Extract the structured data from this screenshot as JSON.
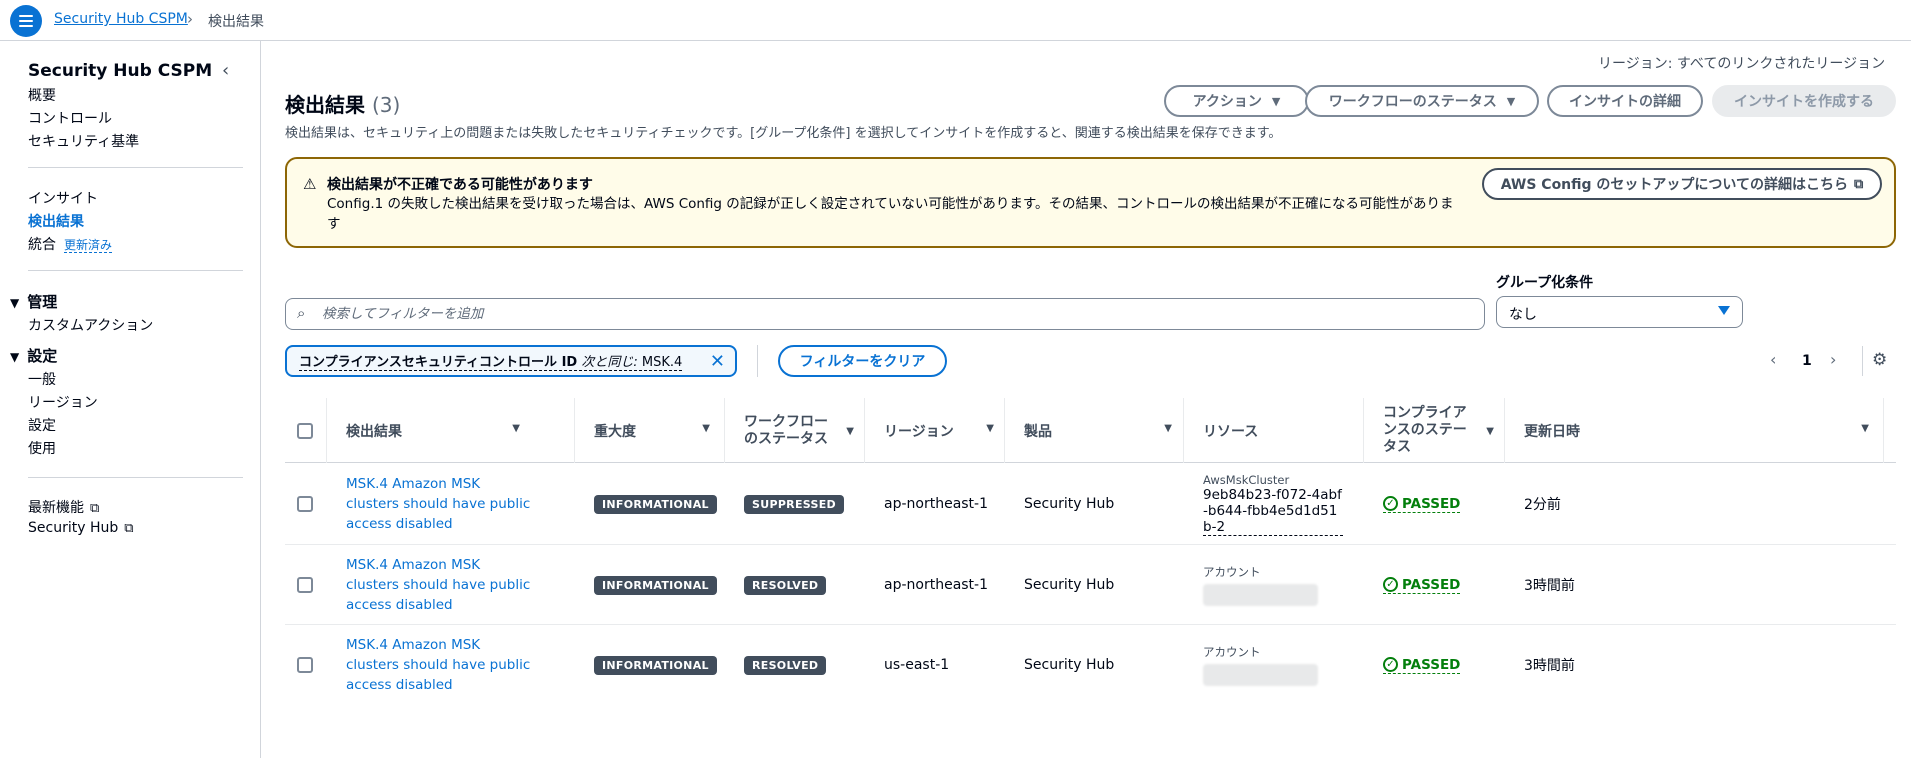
{
  "topbar": {
    "breadcrumb_link": "Security Hub CSPM",
    "breadcrumb_current": "検出結果"
  },
  "sidebar": {
    "title": "Security Hub CSPM",
    "group1": [
      "概要",
      "コントロール",
      "セキュリティ基準"
    ],
    "group2": {
      "insights": "インサイト",
      "findings": "検出結果",
      "integrations": "統合",
      "updated_badge": "更新済み"
    },
    "manage_section": "管理",
    "custom_actions": "カスタムアクション",
    "settings_section": "設定",
    "settings_items": [
      "一般",
      "リージョン",
      "設定",
      "使用"
    ],
    "whats_new": "最新機能",
    "security_hub": "Security Hub"
  },
  "header": {
    "region": "リージョン: すべてのリンクされたリージョン",
    "title": "検出結果",
    "count": "(3)",
    "description": "検出結果は、セキュリティ上の問題または失敗したセキュリティチェックです。[グループ化条件] を選択してインサイトを作成すると、関連する検出結果を保存できます。",
    "actions_btn": "アクション",
    "workflow_btn": "ワークフローのステータス",
    "insight_details_btn": "インサイトの詳細",
    "create_insight_btn": "インサイトを作成する"
  },
  "alert": {
    "title": "検出結果が不正確である可能性があります",
    "body": "Config.1 の失敗した検出結果を受け取った場合は、AWS Config の記録が正しく設定されていない可能性があります。その結果、コントロールの検出結果が不正確になる可能性があります",
    "link_btn": "AWS Config のセットアップについての詳細はこちら"
  },
  "search": {
    "placeholder": "検索してフィルターを追加"
  },
  "group_by": {
    "label": "グループ化条件",
    "value": "なし"
  },
  "filter": {
    "key": "コンプライアンスセキュリティコントロール ID",
    "operator": "次と同じ:",
    "value": "MSK.4",
    "clear_btn": "フィルターをクリア"
  },
  "pagination": {
    "current_page": "1"
  },
  "table": {
    "columns": {
      "finding": "検出結果",
      "severity": "重大度",
      "workflow_line1": "ワークフロー",
      "workflow_line2": "のステータス",
      "region": "リージョン",
      "product": "製品",
      "resource": "リソース",
      "compliance_line1": "コンプライア",
      "compliance_line2": "ンスのステー",
      "compliance_line3": "タス",
      "updated": "更新日時"
    },
    "rows": [
      {
        "title": "MSK.4 Amazon MSK clusters should have public access disabled",
        "severity": "INFORMATIONAL",
        "workflow": "SUPPRESSED",
        "region": "ap-northeast-1",
        "product": "Security Hub",
        "resource_label": "AwsMskCluster",
        "resource_id": "9eb84b23-f072-4abf-b644-fbb4e5d1d51b-2",
        "compliance": "PASSED",
        "updated": "2分前"
      },
      {
        "title": "MSK.4 Amazon MSK clusters should have public access disabled",
        "severity": "INFORMATIONAL",
        "workflow": "RESOLVED",
        "region": "ap-northeast-1",
        "product": "Security Hub",
        "resource_label": "アカウント",
        "resource_id": "",
        "compliance": "PASSED",
        "updated": "3時間前"
      },
      {
        "title": "MSK.4 Amazon MSK clusters should have public access disabled",
        "severity": "INFORMATIONAL",
        "workflow": "RESOLVED",
        "region": "us-east-1",
        "product": "Security Hub",
        "resource_label": "アカウント",
        "resource_id": "",
        "compliance": "PASSED",
        "updated": "3時間前"
      }
    ]
  },
  "colors": {
    "accent": "#0972d3",
    "success": "#037f0c",
    "warning_border": "#8d6605",
    "warning_bg": "#fffce9",
    "badge_bg": "#414d5c"
  },
  "icons": {
    "menu": "hamburger-icon",
    "alert": "warning-triangle-icon",
    "search": "search-icon",
    "external": "external-link-icon",
    "settings": "gear-icon"
  }
}
